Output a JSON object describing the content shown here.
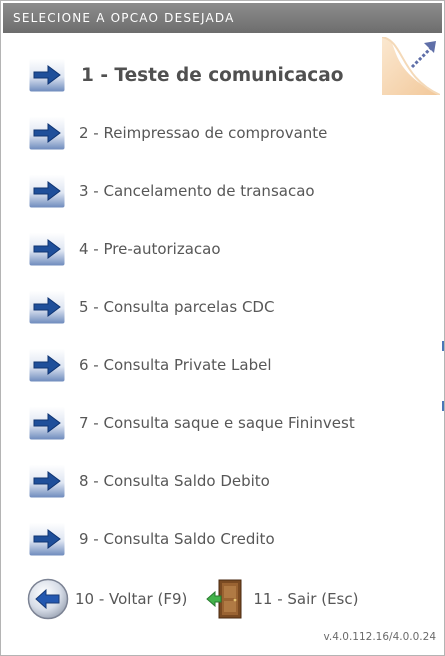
{
  "title": "Selecione a opcao desejada",
  "menu": {
    "items": [
      {
        "label": "1 - Teste de comunicacao",
        "selected": true
      },
      {
        "label": "2 - Reimpressao de comprovante",
        "selected": false
      },
      {
        "label": "3 - Cancelamento de transacao",
        "selected": false
      },
      {
        "label": "4 - Pre-autorizacao",
        "selected": false
      },
      {
        "label": "5 - Consulta parcelas CDC",
        "selected": false
      },
      {
        "label": "6 - Consulta Private Label",
        "selected": false
      },
      {
        "label": "7 - Consulta saque e saque Fininvest",
        "selected": false
      },
      {
        "label": "8 - Consulta Saldo Debito",
        "selected": false
      },
      {
        "label": "9 - Consulta Saldo Credito",
        "selected": false
      }
    ]
  },
  "footer": {
    "back_label": "10 - Voltar (F9)",
    "exit_label": "11 - Sair (Esc)",
    "version": "v.4.0.112.16/4.0.0.24"
  },
  "icons": {
    "menu_item": "arrow-right-icon",
    "back": "arrow-left-circle-icon",
    "exit": "door-exit-icon",
    "corner": "resize-corner-icon"
  },
  "colors": {
    "titlebar": "#7a7a7a",
    "arrow_blue": "#1f4f9a",
    "text": "#575757"
  }
}
